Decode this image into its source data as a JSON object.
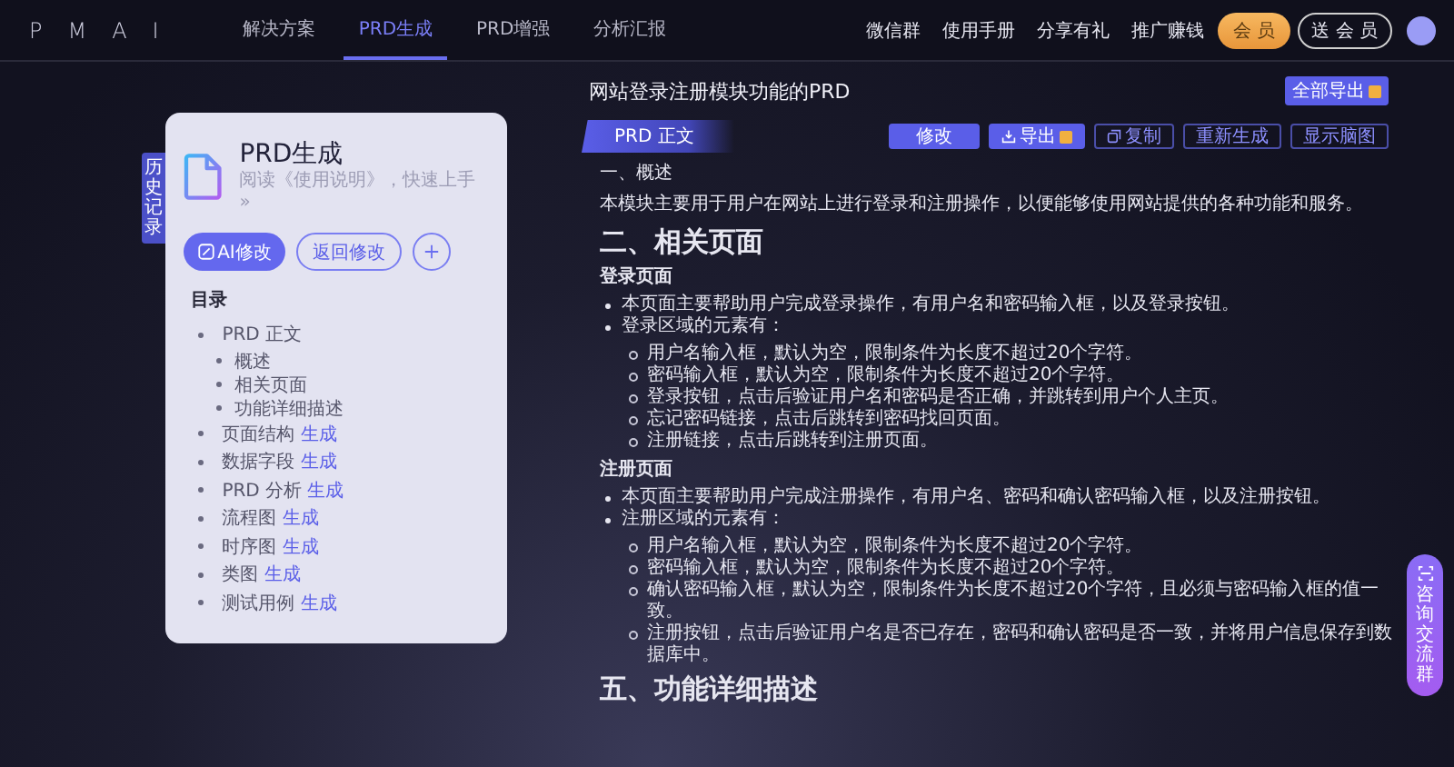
{
  "nav": {
    "logo": "PMAI",
    "tabs": [
      {
        "label": "解决方案",
        "selected": false
      },
      {
        "label": "PRD生成",
        "selected": true
      },
      {
        "label": "PRD增强",
        "selected": false
      },
      {
        "label": "分析汇报",
        "selected": false
      }
    ],
    "links": [
      "微信群",
      "使用手册",
      "分享有礼",
      "推广赚钱"
    ],
    "member": "会 员",
    "gift_member": "送 会 员"
  },
  "history_tab": "历史记录",
  "card": {
    "title": "PRD生成",
    "subtitle": "阅读《使用说明》，快速上手 »",
    "ai_edit": "AI修改",
    "back_edit": "返回修改",
    "toc_heading": "目录",
    "toc": [
      {
        "label": "PRD 正文",
        "children": [
          {
            "label": "概述"
          },
          {
            "label": "相关页面"
          },
          {
            "label": "功能详细描述"
          }
        ]
      },
      {
        "label": "页面结构",
        "action": "生成"
      },
      {
        "label": "数据字段",
        "action": "生成"
      },
      {
        "label": "PRD 分析",
        "action": "生成"
      },
      {
        "label": "流程图",
        "action": "生成"
      },
      {
        "label": "时序图",
        "action": "生成"
      },
      {
        "label": "类图",
        "action": "生成"
      },
      {
        "label": "测试用例",
        "action": "生成"
      }
    ]
  },
  "doc": {
    "title": "网站登录注册模块功能的PRD",
    "export_all": "全部导出",
    "section_tab": "PRD 正文",
    "actions": [
      {
        "label": "修改",
        "kind": "primary"
      },
      {
        "label": "导出",
        "kind": "export"
      },
      {
        "label": "复制",
        "kind": "copy"
      },
      {
        "label": "重新生成",
        "kind": "outline"
      },
      {
        "label": "显示脑图",
        "kind": "outline"
      }
    ],
    "body": [
      {
        "kind": "h5",
        "text": "一、概述"
      },
      {
        "kind": "p",
        "text": "本模块主要用于用户在网站上进行登录和注册操作，以便能够使用网站提供的各种功能和服务。"
      },
      {
        "kind": "h2",
        "text": "二、相关页面"
      },
      {
        "kind": "h4",
        "text": "登录页面"
      },
      {
        "kind": "ul",
        "items": [
          {
            "text": "本页面主要帮助用户完成登录操作，有用户名和密码输入框，以及登录按钮。"
          },
          {
            "text": "登录区域的元素有：",
            "children": [
              "用户名输入框，默认为空，限制条件为长度不超过20个字符。",
              "密码输入框，默认为空，限制条件为长度不超过20个字符。",
              "登录按钮，点击后验证用户名和密码是否正确，并跳转到用户个人主页。",
              "忘记密码链接，点击后跳转到密码找回页面。",
              "注册链接，点击后跳转到注册页面。"
            ]
          }
        ]
      },
      {
        "kind": "h4",
        "text": "注册页面"
      },
      {
        "kind": "ul",
        "items": [
          {
            "text": "本页面主要帮助用户完成注册操作，有用户名、密码和确认密码输入框，以及注册按钮。"
          },
          {
            "text": "注册区域的元素有：",
            "children": [
              "用户名输入框，默认为空，限制条件为长度不超过20个字符。",
              "密码输入框，默认为空，限制条件为长度不超过20个字符。",
              "确认密码输入框，默认为空，限制条件为长度不超过20个字符，且必须与密码输入框的值一致。",
              "注册按钮，点击后验证用户名是否已存在，密码和确认密码是否一致，并将用户信息保存到数据库中。"
            ]
          }
        ]
      },
      {
        "kind": "h2",
        "text": "五、功能详细描述"
      }
    ]
  },
  "float_button": "咨询交流群"
}
